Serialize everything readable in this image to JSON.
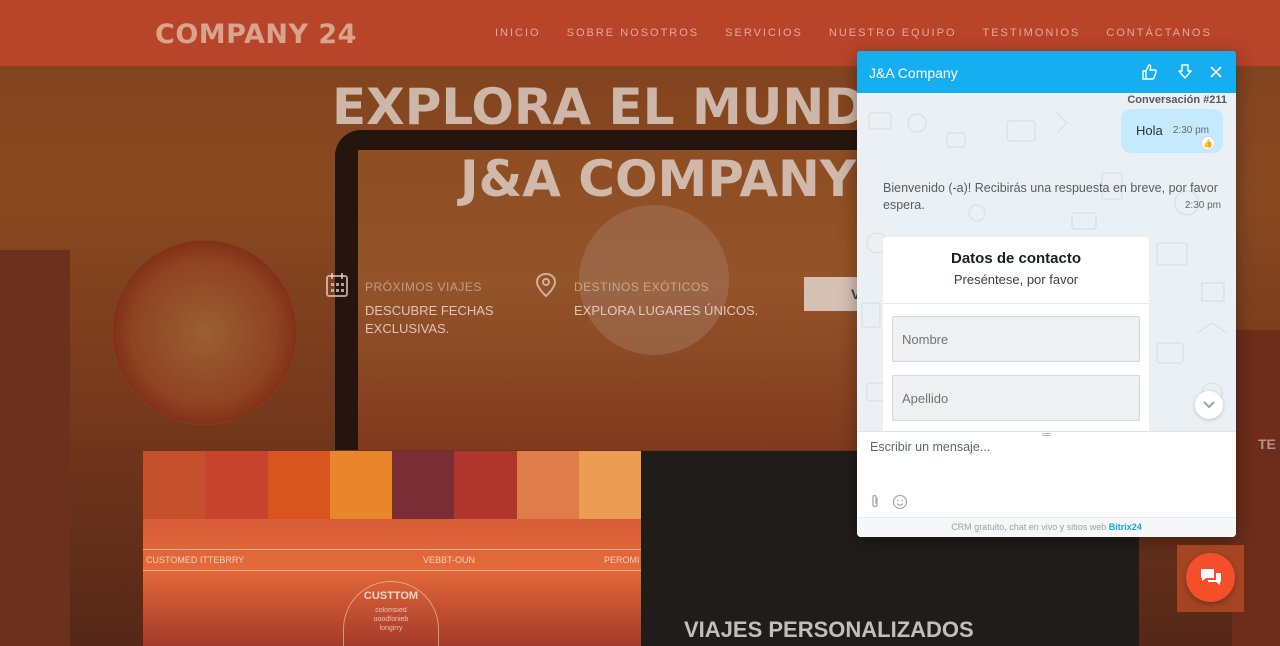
{
  "site": {
    "logo": "COMPANY 24",
    "nav": [
      "INICIO",
      "SOBRE NOSOTROS",
      "SERVICIOS",
      "NUESTRO EQUIPO",
      "TESTIMONIOS",
      "CONTÁCTANOS"
    ],
    "hero_line1": "EXPLORA EL MUNDO C",
    "hero_line2": "J&A COMPANY",
    "features": [
      {
        "title": "PRÓXIMOS VIAJES",
        "text": "DESCUBRE FECHAS EXCLUSIVAS.",
        "icon": "calendar-icon"
      },
      {
        "title": "DESTINOS EXÓTICOS",
        "text": "EXPLORA LUGARES ÚNICOS.",
        "icon": "map-pin-icon"
      }
    ],
    "hero_button": "V",
    "card_strip": [
      "CUSTOMED ITTEBRRY",
      "VEBBT-OUN",
      "PEROMI"
    ],
    "badge_title": "CUSTTOM",
    "badge_sub": [
      "colomsied",
      "uoodfonieb",
      "longirry"
    ],
    "card_right_title": "VIAJES PERSONALIZADOS",
    "side_text": "TE",
    "swatch_colors": [
      "#c4512c",
      "#c7432e",
      "#d9551f",
      "#e9862b",
      "#7a2d35",
      "#b0352c",
      "#df7c4a",
      "#ed9d53"
    ]
  },
  "chat": {
    "title": "J&A Company",
    "conversation_label": "Conversación #211",
    "outgoing": {
      "text": "Hola",
      "time": "2:30 pm"
    },
    "system": {
      "text": "Bienvenido (-a)! Recibirás una respuesta en breve, por favor espera.",
      "time": "2:30 pm"
    },
    "form": {
      "title": "Datos de contacto",
      "subtitle": "Preséntese, por favor",
      "first_name_placeholder": "Nombre",
      "last_name_placeholder": "Apellido"
    },
    "input_placeholder": "Escribir un mensaje...",
    "footer_text": "CRM gratuito, chat en vivo y sitios web",
    "footer_brand": "Bitrix24",
    "accent": "#15aef0",
    "launcher_color": "#f44f2a"
  }
}
